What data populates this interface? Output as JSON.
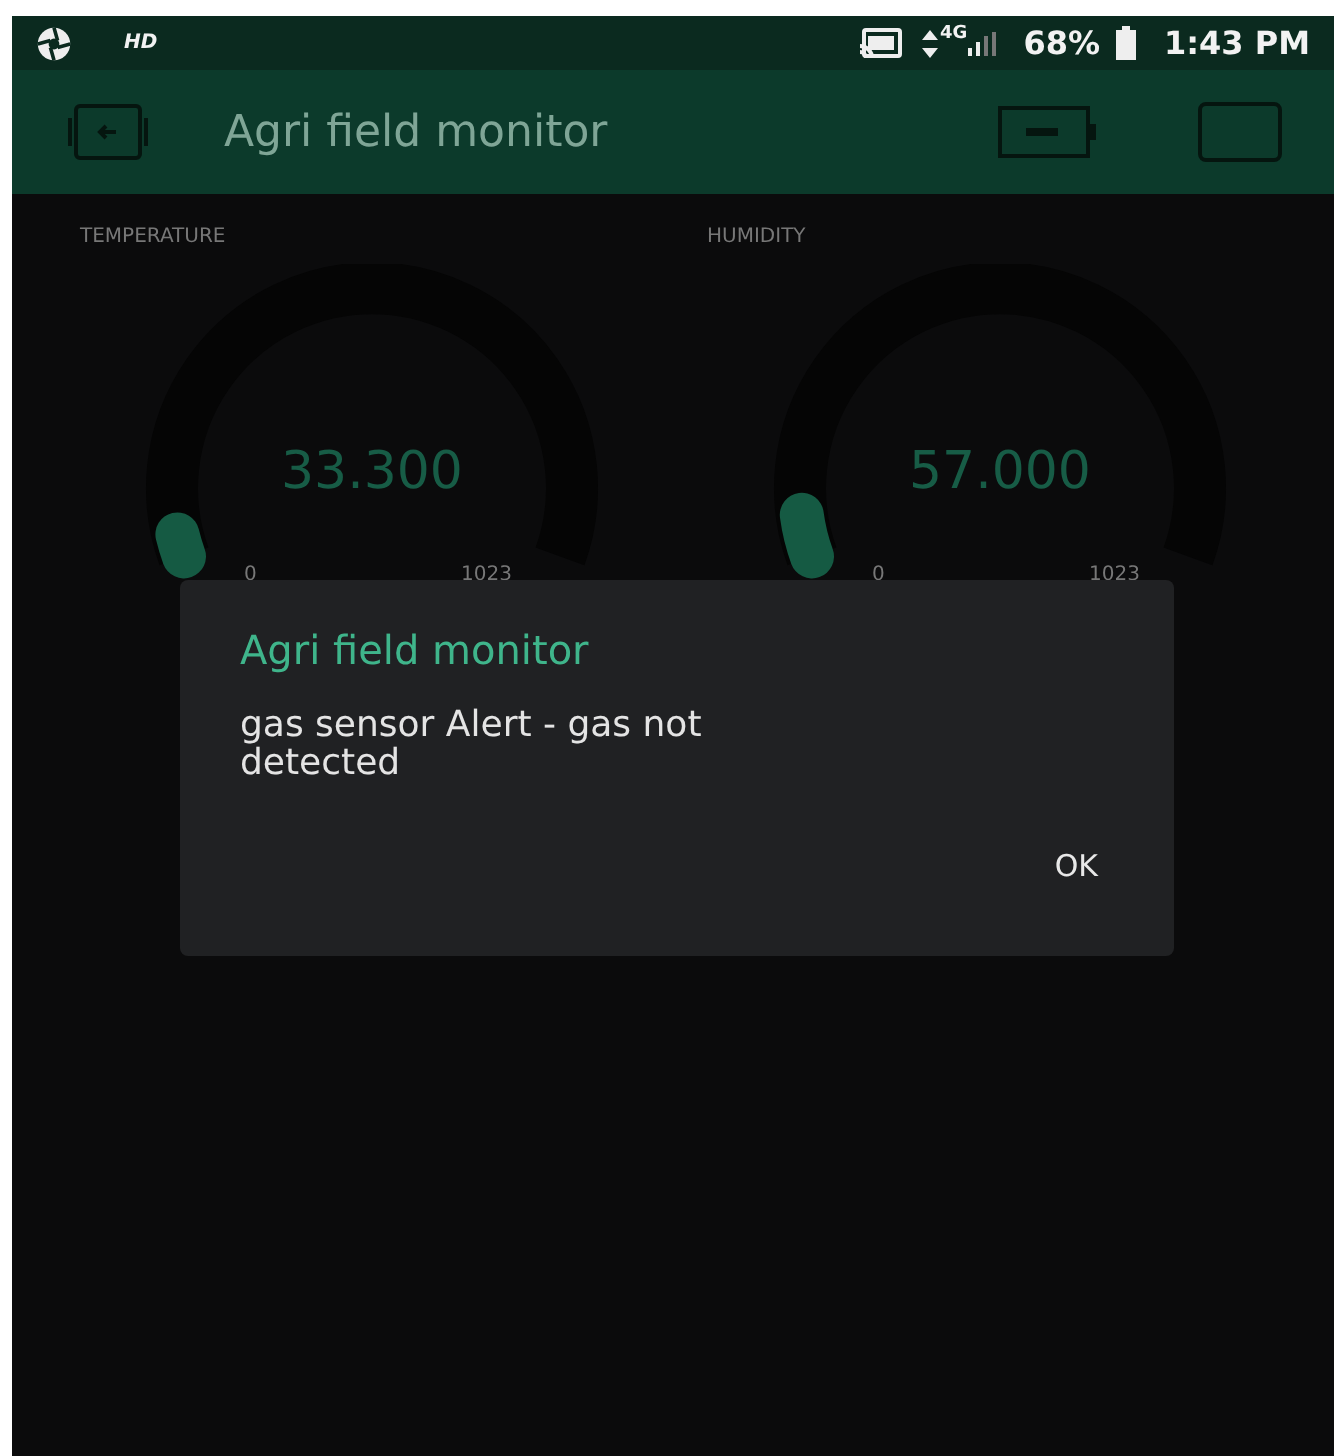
{
  "status_bar": {
    "hd": "HD",
    "network": "4G",
    "battery": "68%",
    "time": "1:43 PM"
  },
  "app_bar": {
    "title": "Agri field monitor"
  },
  "gauges": [
    {
      "label": "TEMPERATURE",
      "value": "33.300",
      "min": "0",
      "max": "1023",
      "level": 0.03
    },
    {
      "label": "HUMIDITY",
      "value": "57.000",
      "min": "0",
      "max": "1023",
      "level": 0.056
    }
  ],
  "dialog": {
    "title": "Agri field monitor",
    "message": "gas sensor Alert - gas not detected",
    "buttons": [
      "OK"
    ]
  }
}
